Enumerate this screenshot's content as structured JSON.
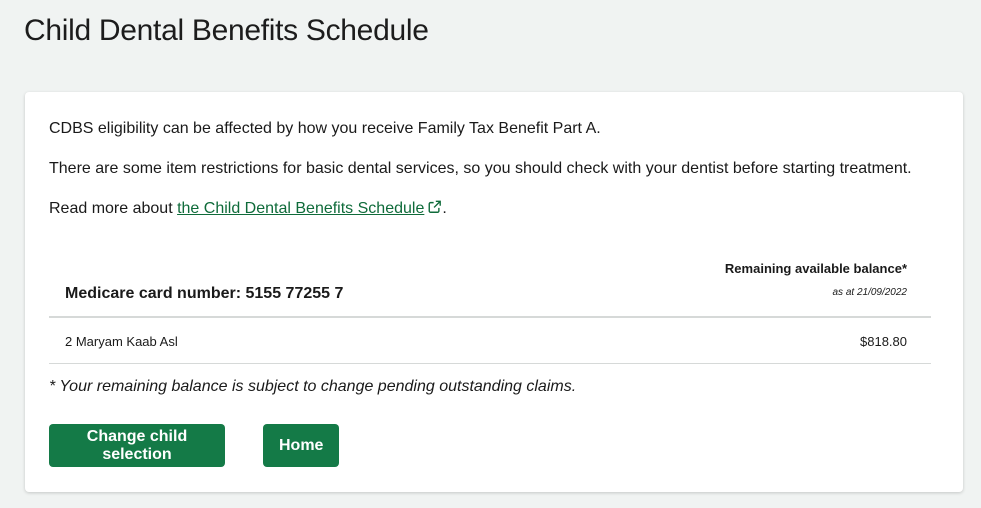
{
  "page": {
    "title": "Child Dental Benefits Schedule"
  },
  "info": {
    "line1": "CDBS eligibility can be affected by how you receive Family Tax Benefit Part A.",
    "line2": "There are some item restrictions for basic dental services, so you should check with your dentist before starting treatment.",
    "line3_prefix": "Read more about ",
    "line3_link": "the Child Dental Benefits Schedule",
    "line3_link_icon": "external-link-icon",
    "line3_suffix": "."
  },
  "table": {
    "card_label": "Medicare card number: 5155 77255 7",
    "balance_header": "Remaining available balance*",
    "as_at": "as at 21/09/2022",
    "rows": [
      {
        "name": "2 Maryam Kaab Asl",
        "amount": "$818.80"
      }
    ]
  },
  "footnote": "* Your remaining balance is subject to change pending outstanding claims.",
  "buttons": {
    "change_child": "Change child selection",
    "home": "Home"
  },
  "colors": {
    "accent": "#147a47",
    "link": "#0f6b3a",
    "background": "#f0f3f2"
  }
}
